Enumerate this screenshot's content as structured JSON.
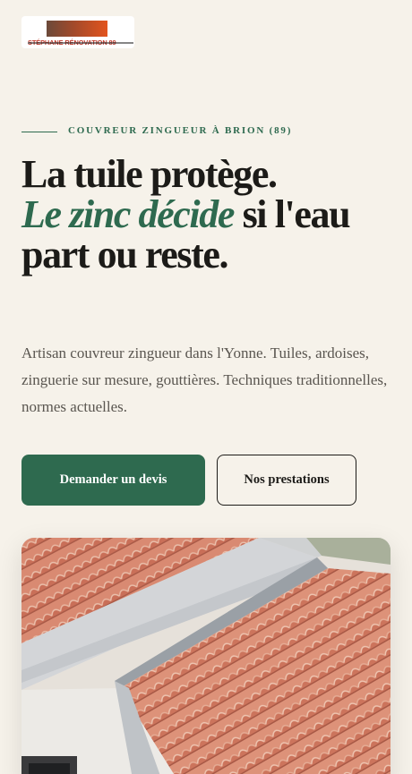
{
  "brand": {
    "logo_text": "STÉPHANE RÉNOVATION 89"
  },
  "hero": {
    "eyebrow": "COUVREUR ZINGUEUR À BRION (89)",
    "headline_part1": "La tuile protège.",
    "headline_accent": "Le zinc décide",
    "headline_part2": " si l'eau part ou reste.",
    "lede": "Artisan couvreur zingueur dans l'Yonne. Tuiles, ardoises, zinguerie sur mesure, gouttières. Techniques traditionnelles, normes actuelles.",
    "cta_primary": "Demander un devis",
    "cta_secondary": "Nos prestations"
  },
  "colors": {
    "background": "#f6f2ea",
    "accent_green": "#2e6a4f",
    "text_dark": "#1c1b18",
    "text_muted": "#5a5650",
    "tile_terracotta": "#d98a72"
  },
  "photo": {
    "subject": "roof-tiles-photo"
  }
}
